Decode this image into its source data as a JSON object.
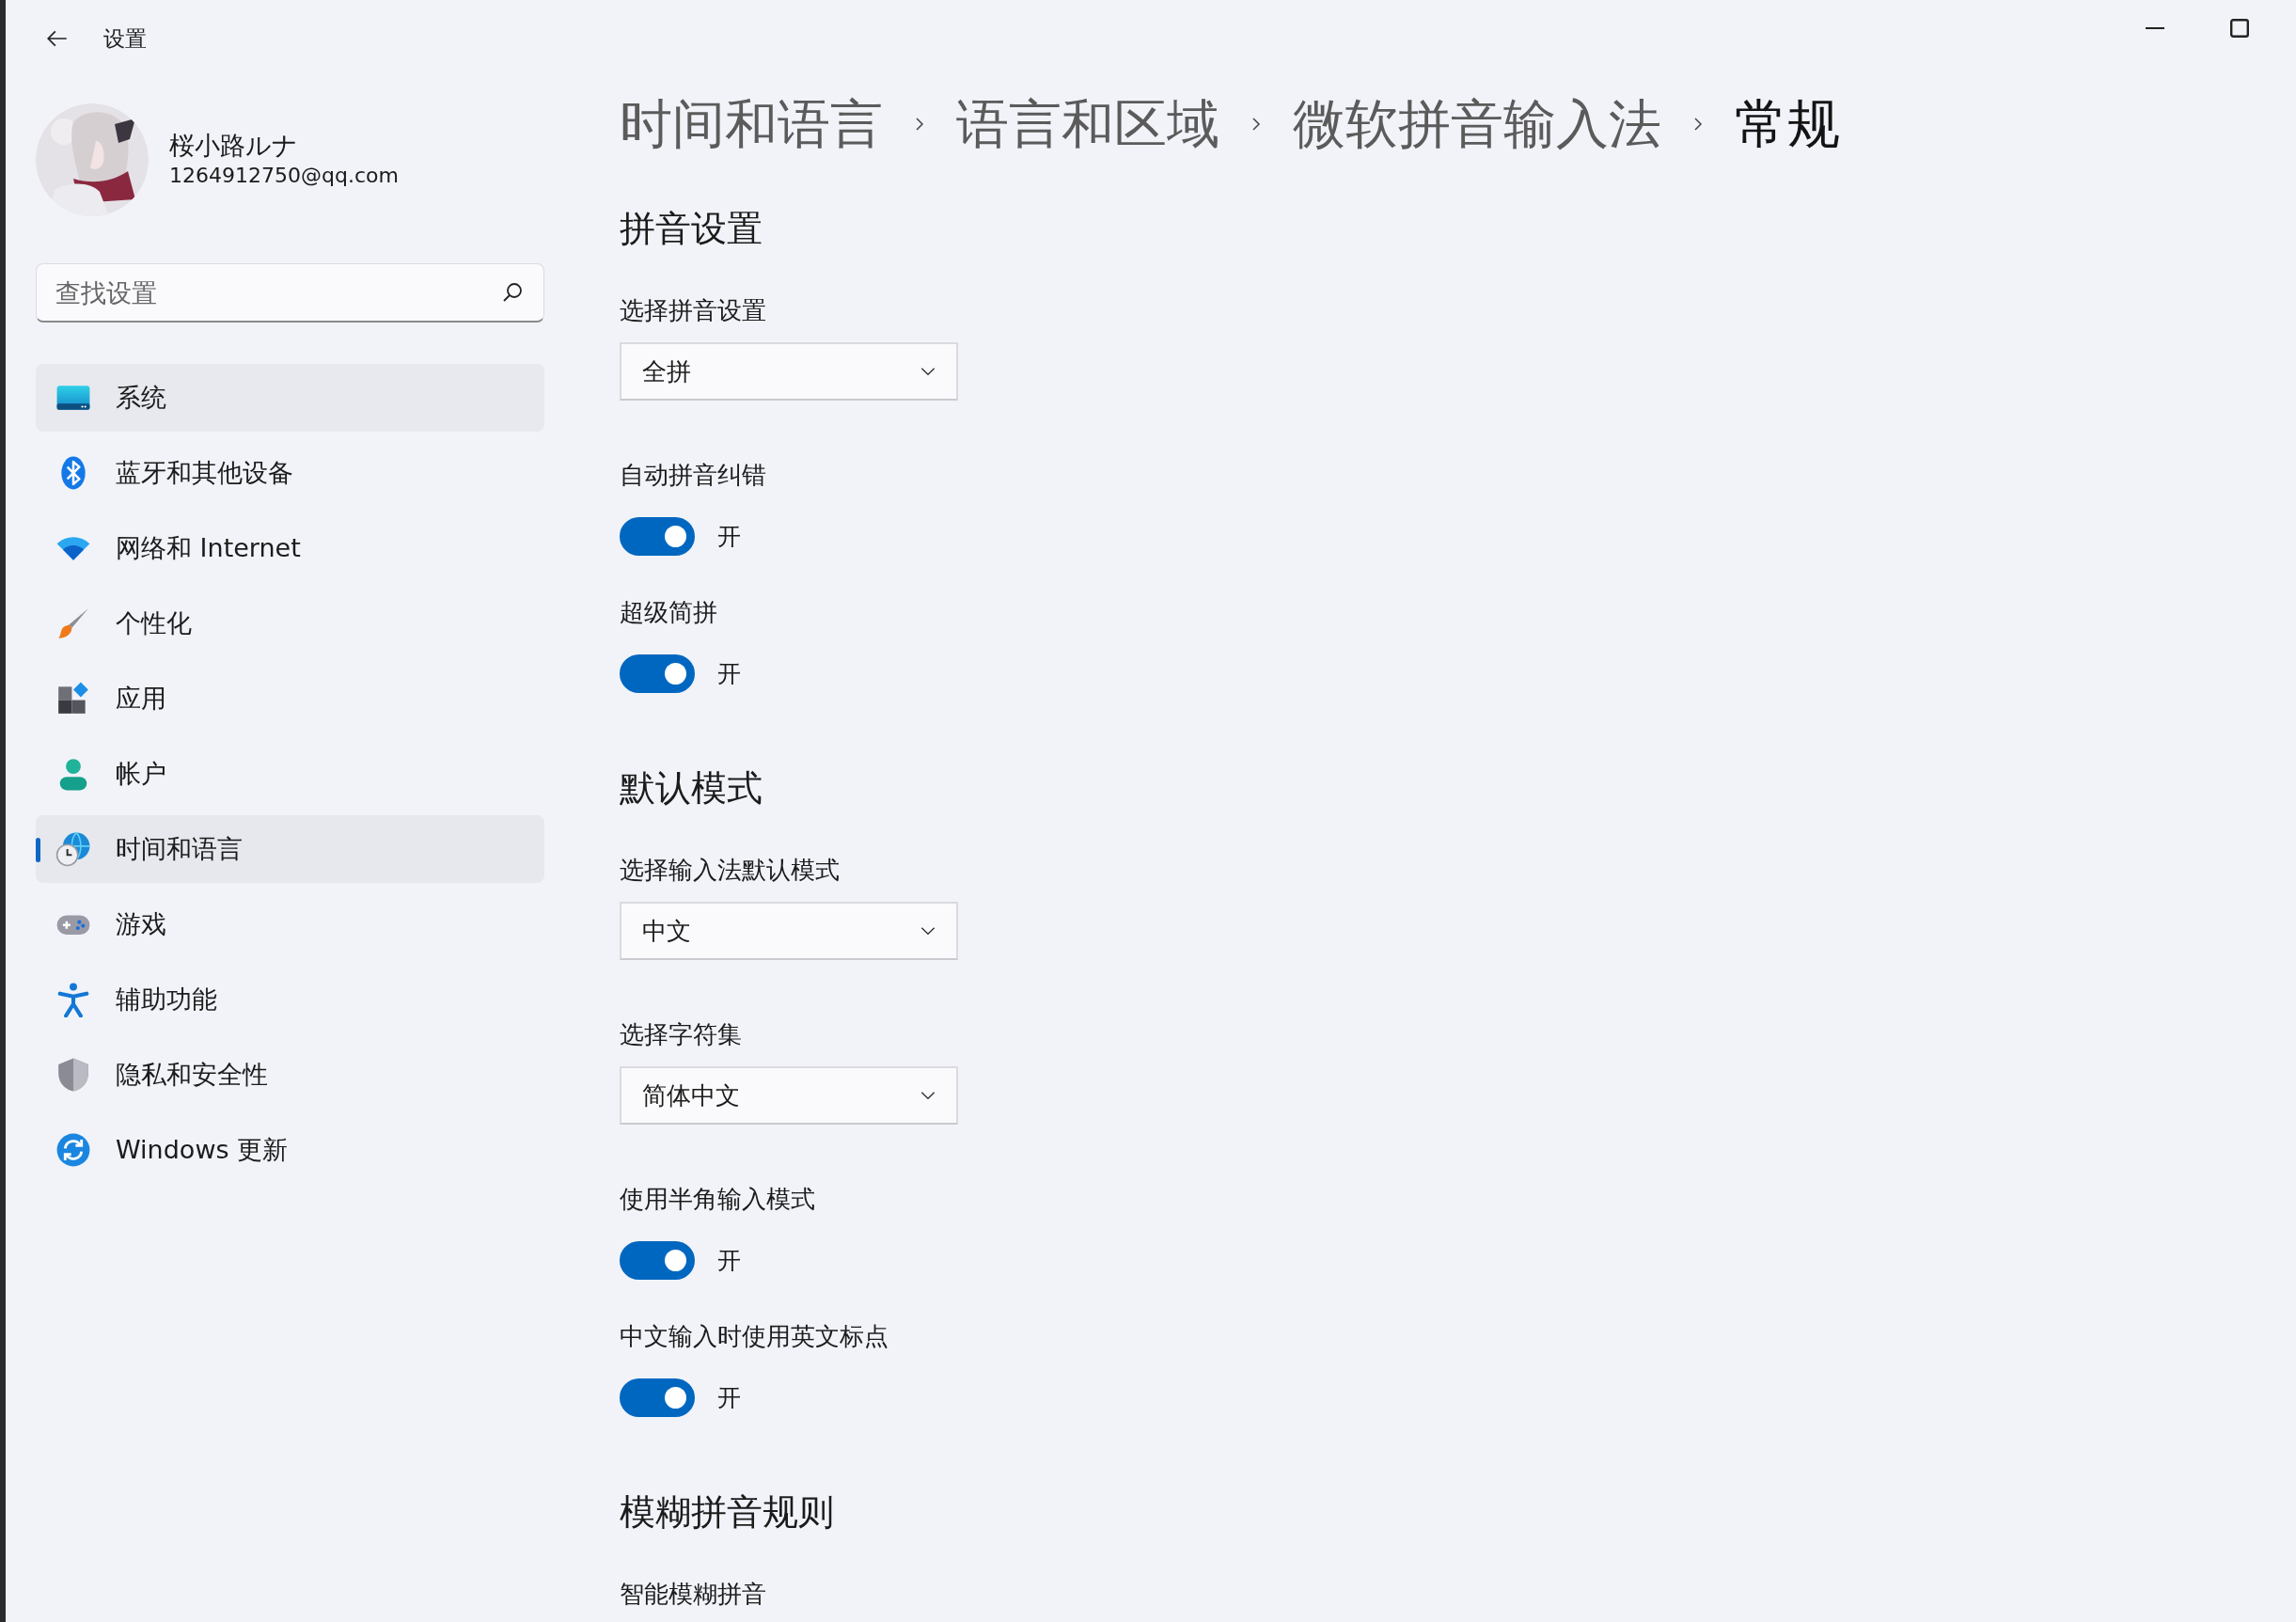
{
  "window": {
    "title": "设置"
  },
  "account": {
    "name": "桜小路ルナ",
    "email": "1264912750@qq.com"
  },
  "search": {
    "placeholder": "查找设置"
  },
  "nav": [
    {
      "label": "系统",
      "selected": false,
      "hovered": true
    },
    {
      "label": "蓝牙和其他设备",
      "selected": false,
      "hovered": false
    },
    {
      "label": "网络和 Internet",
      "selected": false,
      "hovered": false
    },
    {
      "label": "个性化",
      "selected": false,
      "hovered": false
    },
    {
      "label": "应用",
      "selected": false,
      "hovered": false
    },
    {
      "label": "帐户",
      "selected": false,
      "hovered": false
    },
    {
      "label": "时间和语言",
      "selected": true,
      "hovered": false
    },
    {
      "label": "游戏",
      "selected": false,
      "hovered": false
    },
    {
      "label": "辅助功能",
      "selected": false,
      "hovered": false
    },
    {
      "label": "隐私和安全性",
      "selected": false,
      "hovered": false
    },
    {
      "label": "Windows 更新",
      "selected": false,
      "hovered": false
    }
  ],
  "breadcrumb": [
    {
      "label": "时间和语言",
      "current": false
    },
    {
      "label": "语言和区域",
      "current": false
    },
    {
      "label": "微软拼音输入法",
      "current": false
    },
    {
      "label": "常规",
      "current": true
    }
  ],
  "sections": [
    {
      "title": "拼音设置",
      "settings": [
        {
          "kind": "dropdown",
          "label": "选择拼音设置",
          "value": "全拼"
        },
        {
          "kind": "toggle",
          "label": "自动拼音纠错",
          "on": true,
          "state_text": "开"
        },
        {
          "kind": "toggle",
          "label": "超级简拼",
          "on": true,
          "state_text": "开"
        }
      ]
    },
    {
      "title": "默认模式",
      "settings": [
        {
          "kind": "dropdown",
          "label": "选择输入法默认模式",
          "value": "中文"
        },
        {
          "kind": "dropdown",
          "label": "选择字符集",
          "value": "简体中文"
        },
        {
          "kind": "toggle",
          "label": "使用半角输入模式",
          "on": true,
          "state_text": "开"
        },
        {
          "kind": "toggle",
          "label": "中文输入时使用英文标点",
          "on": true,
          "state_text": "开"
        }
      ]
    },
    {
      "title": "模糊拼音规则",
      "settings": [
        {
          "kind": "label",
          "label": "智能模糊拼音"
        }
      ]
    }
  ]
}
